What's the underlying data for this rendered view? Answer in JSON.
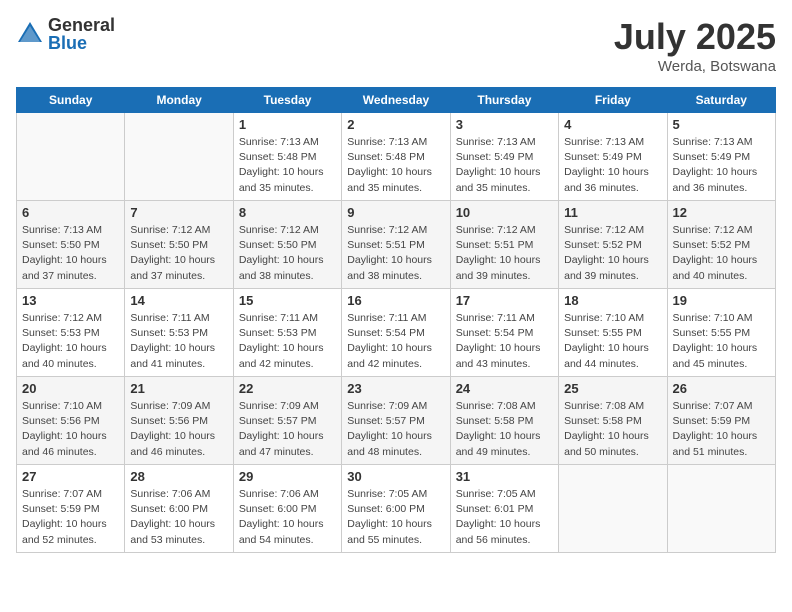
{
  "logo": {
    "general": "General",
    "blue": "Blue"
  },
  "title": "July 2025",
  "subtitle": "Werda, Botswana",
  "weekdays": [
    "Sunday",
    "Monday",
    "Tuesday",
    "Wednesday",
    "Thursday",
    "Friday",
    "Saturday"
  ],
  "weeks": [
    [
      {
        "day": "",
        "info": ""
      },
      {
        "day": "",
        "info": ""
      },
      {
        "day": "1",
        "info": "Sunrise: 7:13 AM\nSunset: 5:48 PM\nDaylight: 10 hours\nand 35 minutes."
      },
      {
        "day": "2",
        "info": "Sunrise: 7:13 AM\nSunset: 5:48 PM\nDaylight: 10 hours\nand 35 minutes."
      },
      {
        "day": "3",
        "info": "Sunrise: 7:13 AM\nSunset: 5:49 PM\nDaylight: 10 hours\nand 35 minutes."
      },
      {
        "day": "4",
        "info": "Sunrise: 7:13 AM\nSunset: 5:49 PM\nDaylight: 10 hours\nand 36 minutes."
      },
      {
        "day": "5",
        "info": "Sunrise: 7:13 AM\nSunset: 5:49 PM\nDaylight: 10 hours\nand 36 minutes."
      }
    ],
    [
      {
        "day": "6",
        "info": "Sunrise: 7:13 AM\nSunset: 5:50 PM\nDaylight: 10 hours\nand 37 minutes."
      },
      {
        "day": "7",
        "info": "Sunrise: 7:12 AM\nSunset: 5:50 PM\nDaylight: 10 hours\nand 37 minutes."
      },
      {
        "day": "8",
        "info": "Sunrise: 7:12 AM\nSunset: 5:50 PM\nDaylight: 10 hours\nand 38 minutes."
      },
      {
        "day": "9",
        "info": "Sunrise: 7:12 AM\nSunset: 5:51 PM\nDaylight: 10 hours\nand 38 minutes."
      },
      {
        "day": "10",
        "info": "Sunrise: 7:12 AM\nSunset: 5:51 PM\nDaylight: 10 hours\nand 39 minutes."
      },
      {
        "day": "11",
        "info": "Sunrise: 7:12 AM\nSunset: 5:52 PM\nDaylight: 10 hours\nand 39 minutes."
      },
      {
        "day": "12",
        "info": "Sunrise: 7:12 AM\nSunset: 5:52 PM\nDaylight: 10 hours\nand 40 minutes."
      }
    ],
    [
      {
        "day": "13",
        "info": "Sunrise: 7:12 AM\nSunset: 5:53 PM\nDaylight: 10 hours\nand 40 minutes."
      },
      {
        "day": "14",
        "info": "Sunrise: 7:11 AM\nSunset: 5:53 PM\nDaylight: 10 hours\nand 41 minutes."
      },
      {
        "day": "15",
        "info": "Sunrise: 7:11 AM\nSunset: 5:53 PM\nDaylight: 10 hours\nand 42 minutes."
      },
      {
        "day": "16",
        "info": "Sunrise: 7:11 AM\nSunset: 5:54 PM\nDaylight: 10 hours\nand 42 minutes."
      },
      {
        "day": "17",
        "info": "Sunrise: 7:11 AM\nSunset: 5:54 PM\nDaylight: 10 hours\nand 43 minutes."
      },
      {
        "day": "18",
        "info": "Sunrise: 7:10 AM\nSunset: 5:55 PM\nDaylight: 10 hours\nand 44 minutes."
      },
      {
        "day": "19",
        "info": "Sunrise: 7:10 AM\nSunset: 5:55 PM\nDaylight: 10 hours\nand 45 minutes."
      }
    ],
    [
      {
        "day": "20",
        "info": "Sunrise: 7:10 AM\nSunset: 5:56 PM\nDaylight: 10 hours\nand 46 minutes."
      },
      {
        "day": "21",
        "info": "Sunrise: 7:09 AM\nSunset: 5:56 PM\nDaylight: 10 hours\nand 46 minutes."
      },
      {
        "day": "22",
        "info": "Sunrise: 7:09 AM\nSunset: 5:57 PM\nDaylight: 10 hours\nand 47 minutes."
      },
      {
        "day": "23",
        "info": "Sunrise: 7:09 AM\nSunset: 5:57 PM\nDaylight: 10 hours\nand 48 minutes."
      },
      {
        "day": "24",
        "info": "Sunrise: 7:08 AM\nSunset: 5:58 PM\nDaylight: 10 hours\nand 49 minutes."
      },
      {
        "day": "25",
        "info": "Sunrise: 7:08 AM\nSunset: 5:58 PM\nDaylight: 10 hours\nand 50 minutes."
      },
      {
        "day": "26",
        "info": "Sunrise: 7:07 AM\nSunset: 5:59 PM\nDaylight: 10 hours\nand 51 minutes."
      }
    ],
    [
      {
        "day": "27",
        "info": "Sunrise: 7:07 AM\nSunset: 5:59 PM\nDaylight: 10 hours\nand 52 minutes."
      },
      {
        "day": "28",
        "info": "Sunrise: 7:06 AM\nSunset: 6:00 PM\nDaylight: 10 hours\nand 53 minutes."
      },
      {
        "day": "29",
        "info": "Sunrise: 7:06 AM\nSunset: 6:00 PM\nDaylight: 10 hours\nand 54 minutes."
      },
      {
        "day": "30",
        "info": "Sunrise: 7:05 AM\nSunset: 6:00 PM\nDaylight: 10 hours\nand 55 minutes."
      },
      {
        "day": "31",
        "info": "Sunrise: 7:05 AM\nSunset: 6:01 PM\nDaylight: 10 hours\nand 56 minutes."
      },
      {
        "day": "",
        "info": ""
      },
      {
        "day": "",
        "info": ""
      }
    ]
  ]
}
